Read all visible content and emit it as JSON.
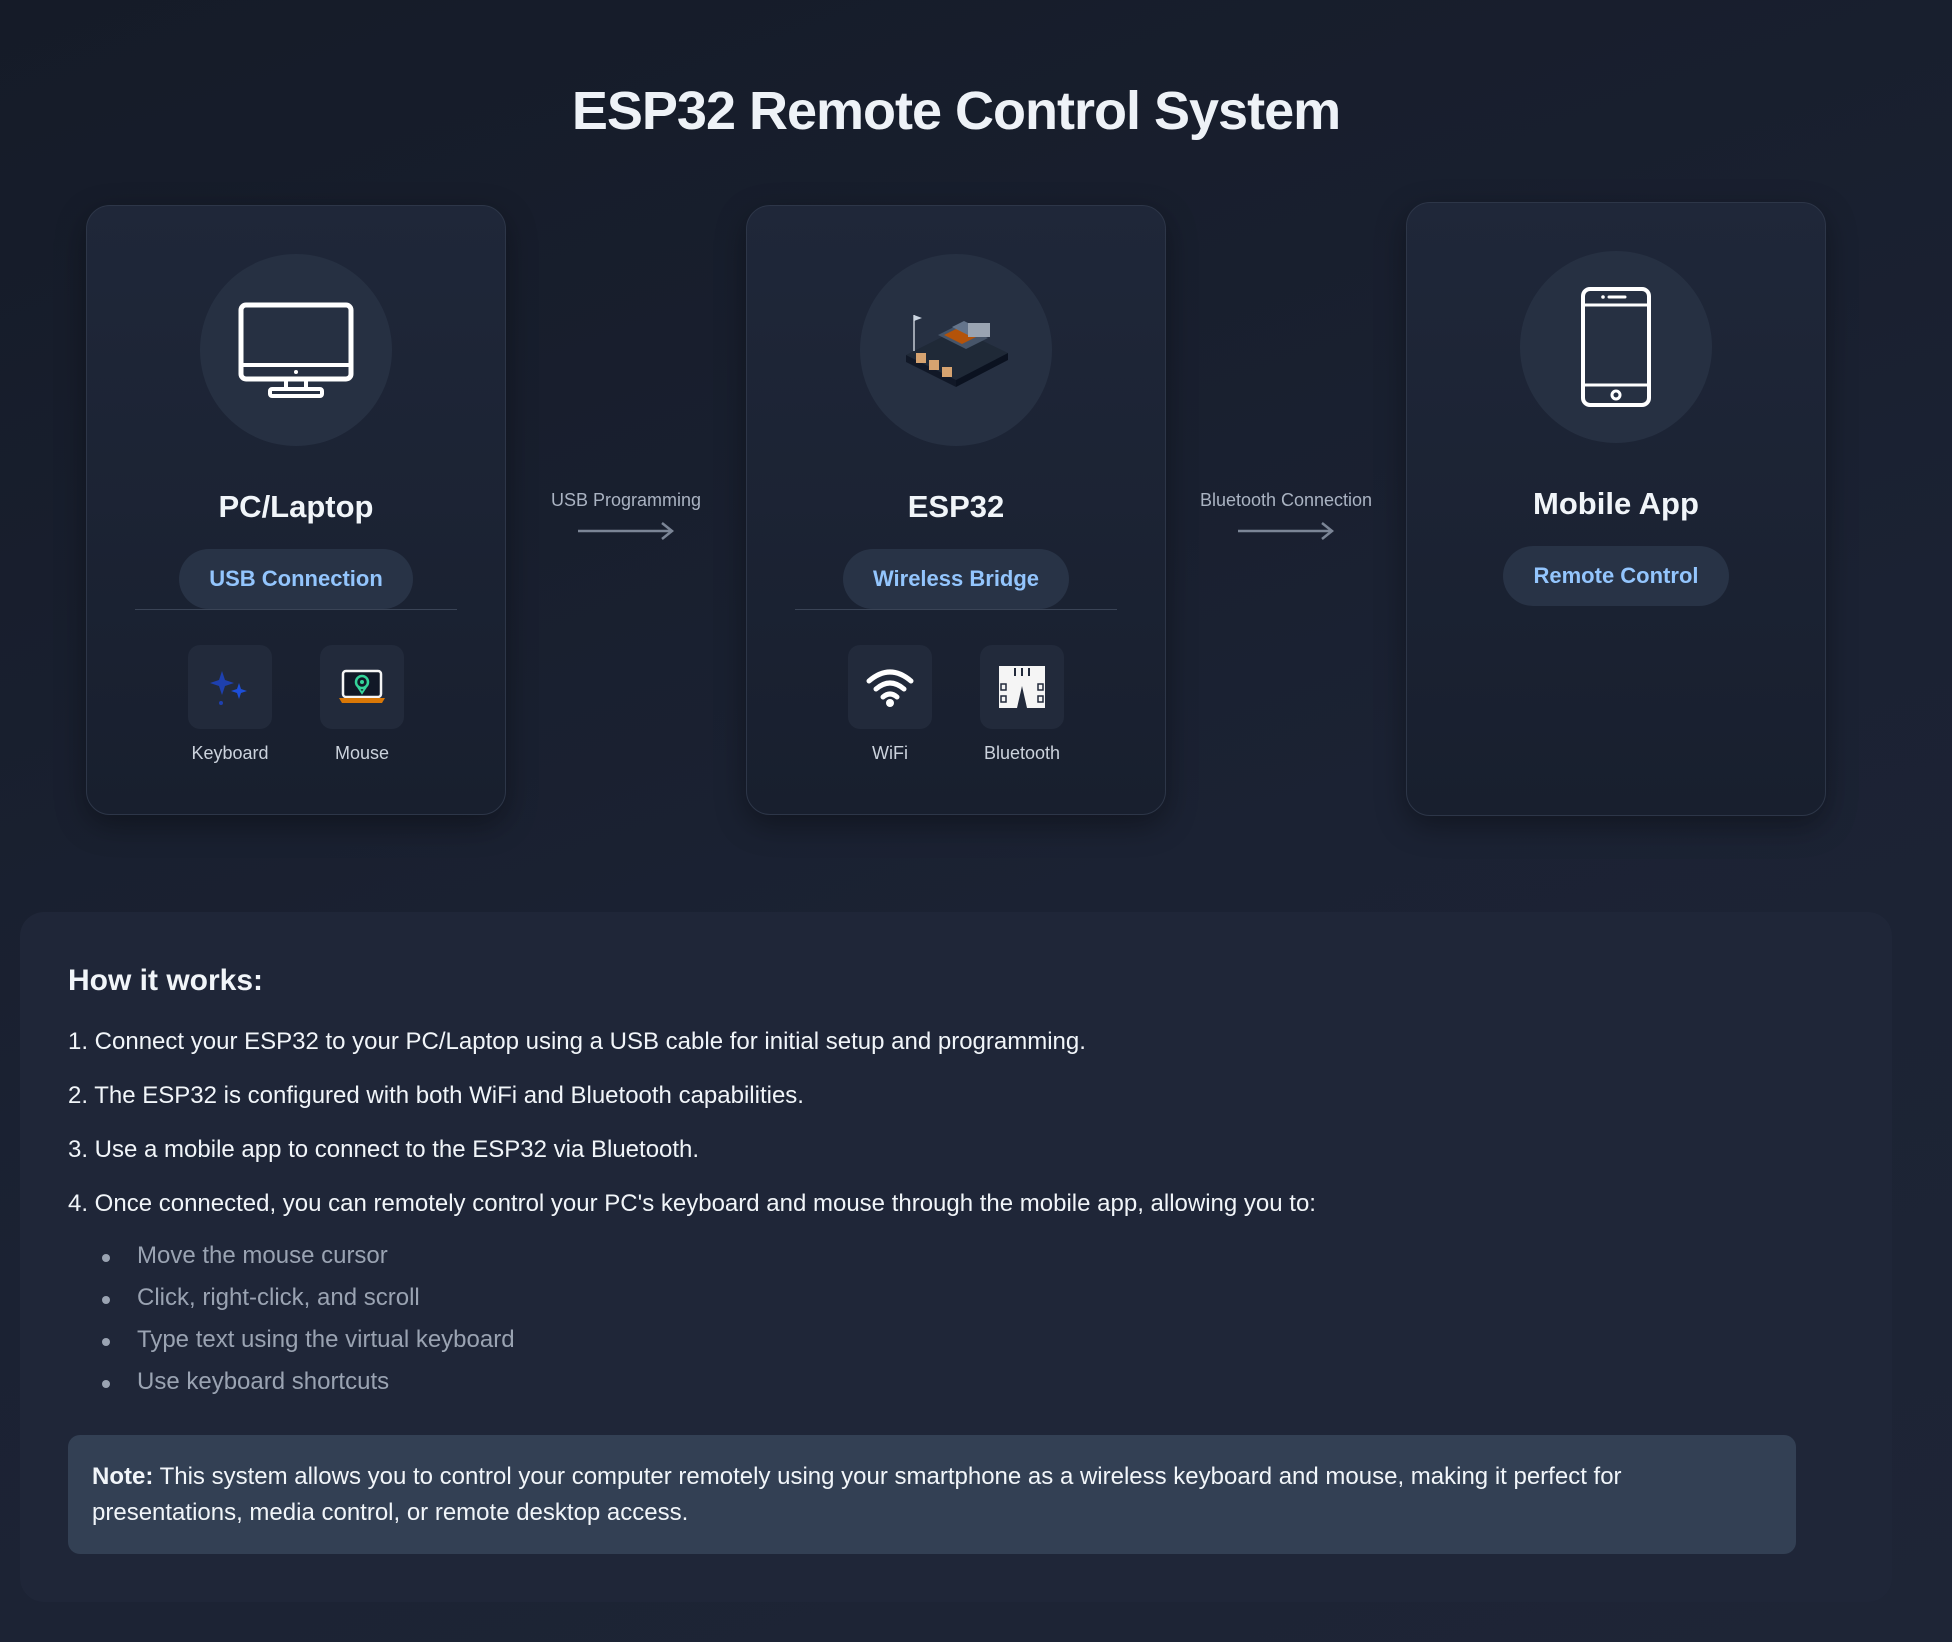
{
  "title": "ESP32 Remote Control System",
  "nodes": [
    {
      "name": "PC/Laptop",
      "icon": "monitor-icon",
      "badge": "USB Connection",
      "features": [
        {
          "label": "Keyboard",
          "icon": "sparkles-icon"
        },
        {
          "label": "Mouse",
          "icon": "laptop-location-icon"
        }
      ]
    },
    {
      "name": "ESP32",
      "icon": "circuit-board-icon",
      "badge": "Wireless Bridge",
      "features": [
        {
          "label": "WiFi",
          "icon": "wifi-icon"
        },
        {
          "label": "Bluetooth",
          "icon": "shorts-icon"
        }
      ]
    },
    {
      "name": "Mobile App",
      "icon": "smartphone-icon",
      "badge": "Remote Control",
      "features": []
    }
  ],
  "connectors": [
    {
      "label": "USB Programming",
      "icon": "arrow-right-icon"
    },
    {
      "label": "Bluetooth Connection",
      "icon": "arrow-right-icon"
    }
  ],
  "info": {
    "heading": "How it works:",
    "steps": [
      "1. Connect your ESP32 to your PC/Laptop using a USB cable for initial setup and programming.",
      "2. The ESP32 is configured with both WiFi and Bluetooth capabilities.",
      "3. Use a mobile app to connect to the ESP32 via Bluetooth.",
      "4. Once connected, you can remotely control your PC's keyboard and mouse through the mobile app, allowing you to:"
    ],
    "bullets": [
      "Move the mouse cursor",
      "Click, right-click, and scroll",
      "Type text using the virtual keyboard",
      "Use keyboard shortcuts"
    ],
    "note_label": "Note:",
    "note_text": " This system allows you to control your computer remotely using your smartphone as a wireless keyboard and mouse, making it perfect for presentations, media control, or remote desktop access."
  },
  "colors": {
    "background": "#1a2030",
    "card": "#1d2535",
    "badge_text": "#93c5fd",
    "note_bg": "#334054"
  }
}
